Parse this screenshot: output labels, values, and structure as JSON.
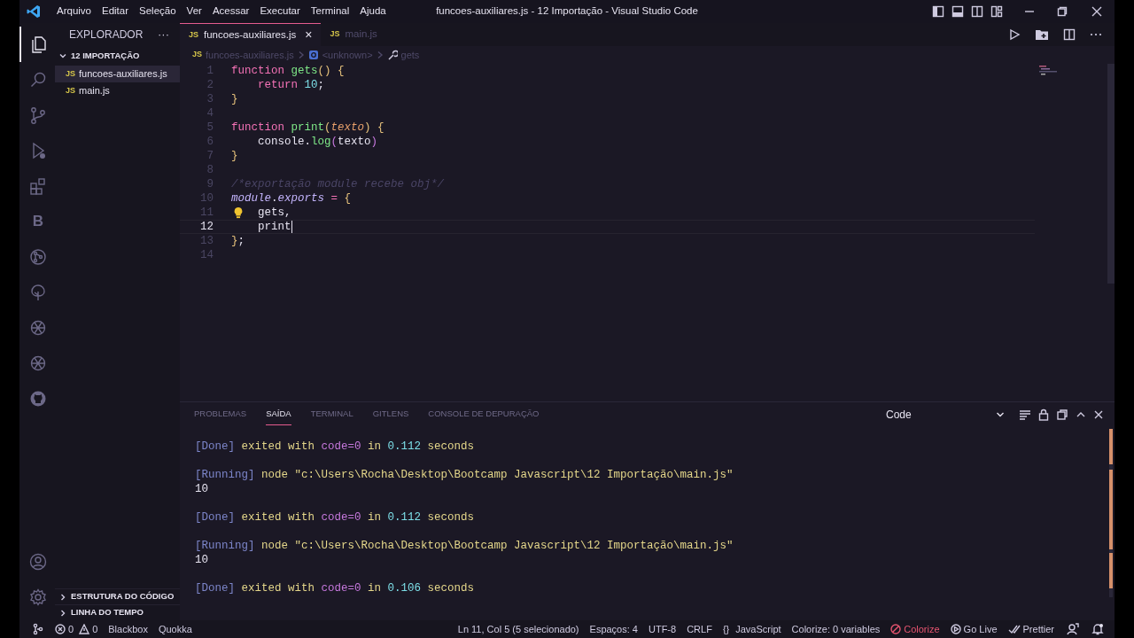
{
  "window": {
    "title": "funcoes-auxiliares.js - 12 Importação - Visual Studio Code"
  },
  "menu": [
    "Arquivo",
    "Editar",
    "Seleção",
    "Ver",
    "Acessar",
    "Executar",
    "Terminal",
    "Ajuda"
  ],
  "activity_bar": {
    "top": [
      {
        "kind": "explorer",
        "selected": true
      },
      {
        "kind": "search",
        "selected": false
      },
      {
        "kind": "source-control",
        "selected": false
      },
      {
        "kind": "run-debug",
        "selected": false
      },
      {
        "kind": "extensions",
        "selected": false
      },
      {
        "kind": "letter",
        "label": "B",
        "selected": false
      },
      {
        "kind": "gitlens",
        "selected": false
      },
      {
        "kind": "tree",
        "selected": false
      },
      {
        "kind": "openai",
        "selected": false
      },
      {
        "kind": "openai",
        "selected": false
      },
      {
        "kind": "github",
        "selected": false
      }
    ],
    "bottom": [
      {
        "kind": "account",
        "selected": false
      },
      {
        "kind": "settings",
        "selected": false
      }
    ]
  },
  "sidebar": {
    "title": "EXPLORADOR",
    "more": "···",
    "folder": {
      "label": "12 IMPORTAÇÃO",
      "expanded": true,
      "files": [
        {
          "badge": "JS",
          "name": "funcoes-auxiliares.js",
          "selected": true
        },
        {
          "badge": "JS",
          "name": "main.js",
          "selected": false
        }
      ]
    },
    "sections": [
      {
        "label": "ESTRUTURA DO CÓDIGO",
        "expanded": false
      },
      {
        "label": "LINHA DO TEMPO",
        "expanded": false
      }
    ]
  },
  "editor_tabs": [
    {
      "badge": "JS",
      "label": "funcoes-auxiliares.js",
      "selected": true,
      "close": "×"
    },
    {
      "badge": "JS",
      "label": "main.js",
      "selected": false
    }
  ],
  "breadcrumb": [
    {
      "badge": "JS",
      "label": "funcoes-auxiliares.js",
      "kind": "file"
    },
    {
      "label": "<unknown>",
      "kind": "object"
    },
    {
      "label": "gets",
      "kind": "wrench"
    }
  ],
  "code_lines": [
    {
      "number": "1",
      "current": false,
      "tokens": [
        {
          "t": "function ",
          "kind": "kw"
        },
        {
          "t": "gets",
          "kind": "fn"
        },
        {
          "t": "() {",
          "kind": "brace"
        }
      ]
    },
    {
      "number": "2",
      "current": false,
      "tokens": [
        {
          "t": "    return ",
          "kind": "kw"
        },
        {
          "t": "10",
          "kind": "num"
        },
        {
          "t": ";",
          "kind": "plain"
        }
      ]
    },
    {
      "number": "3",
      "current": false,
      "tokens": [
        {
          "t": "}",
          "kind": "brace"
        }
      ]
    },
    {
      "number": "4",
      "current": false
    },
    {
      "number": "5",
      "current": false,
      "tokens": [
        {
          "t": "function ",
          "kind": "kw"
        },
        {
          "t": "print",
          "kind": "fn"
        },
        {
          "t": "(",
          "kind": "brace"
        },
        {
          "t": "texto",
          "kind": "param"
        },
        {
          "t": ") {",
          "kind": "brace"
        }
      ]
    },
    {
      "number": "6",
      "current": false,
      "tokens": [
        {
          "t": "    console.",
          "kind": "plain"
        },
        {
          "t": "log",
          "kind": "fn"
        },
        {
          "t": "(",
          "kind": "paren"
        },
        {
          "t": "texto",
          "kind": "plain"
        },
        {
          "t": ")",
          "kind": "paren"
        }
      ]
    },
    {
      "number": "7",
      "current": false,
      "tokens": [
        {
          "t": "}",
          "kind": "brace"
        }
      ]
    },
    {
      "number": "8",
      "current": false
    },
    {
      "number": "9",
      "current": false,
      "tokens": [
        {
          "t": "/*exportação module recebe obj*/",
          "kind": "comment"
        }
      ]
    },
    {
      "number": "10",
      "current": false,
      "tokens": [
        {
          "t": "module",
          "kind": "obj"
        },
        {
          "t": ".",
          "kind": "plain"
        },
        {
          "t": "exports",
          "kind": "obj"
        },
        {
          "t": " = ",
          "kind": "op"
        },
        {
          "t": "{",
          "kind": "brace"
        }
      ]
    },
    {
      "number": "11",
      "current": false,
      "lightbulb": true,
      "tokens": [
        {
          "t": "    gets,",
          "kind": "plain"
        }
      ]
    },
    {
      "number": "12",
      "current": true,
      "cursor": true,
      "tokens": [
        {
          "t": "    print",
          "kind": "plain"
        }
      ]
    },
    {
      "number": "13",
      "current": false,
      "tokens": [
        {
          "t": "}",
          "kind": "brace"
        },
        {
          "t": ";",
          "kind": "plain"
        }
      ]
    },
    {
      "number": "14",
      "current": false
    }
  ],
  "panel": {
    "tabs": [
      {
        "label": "PROBLEMAS",
        "selected": false
      },
      {
        "label": "SAÍDA",
        "selected": true
      },
      {
        "label": "TERMINAL",
        "selected": false
      },
      {
        "label": "GITLENS",
        "selected": false
      },
      {
        "label": "CONSOLE DE DEPURAÇÃO",
        "selected": false
      }
    ],
    "channel": "Code",
    "output": [
      [
        [
          {
            "t": "[Done] ",
            "kind": "tag"
          },
          {
            "t": "exited with ",
            "kind": "text"
          },
          {
            "t": "code=0",
            "kind": "key"
          },
          {
            "t": " in ",
            "kind": "text"
          },
          {
            "t": "0.112",
            "kind": "num"
          },
          {
            "t": " seconds",
            "kind": "text"
          }
        ]
      ],
      [
        [
          {
            "t": "[Running] ",
            "kind": "tag"
          },
          {
            "t": "node \"c:\\Users\\Rocha\\Desktop\\Bootcamp Javascript\\12 Importação\\main.js\"",
            "kind": "text"
          }
        ],
        [
          {
            "t": "10",
            "kind": "out"
          }
        ]
      ],
      [
        [
          {
            "t": "[Done] ",
            "kind": "tag"
          },
          {
            "t": "exited with ",
            "kind": "text"
          },
          {
            "t": "code=0",
            "kind": "key"
          },
          {
            "t": " in ",
            "kind": "text"
          },
          {
            "t": "0.112",
            "kind": "num"
          },
          {
            "t": " seconds",
            "kind": "text"
          }
        ]
      ],
      [
        [
          {
            "t": "[Running] ",
            "kind": "tag"
          },
          {
            "t": "node \"c:\\Users\\Rocha\\Desktop\\Bootcamp Javascript\\12 Importação\\main.js\"",
            "kind": "text"
          }
        ],
        [
          {
            "t": "10",
            "kind": "out"
          }
        ]
      ],
      [
        [
          {
            "t": "[Done] ",
            "kind": "tag"
          },
          {
            "t": "exited with ",
            "kind": "text"
          },
          {
            "t": "code=0",
            "kind": "key"
          },
          {
            "t": " in ",
            "kind": "text"
          },
          {
            "t": "0.106",
            "kind": "num"
          },
          {
            "t": " seconds",
            "kind": "text"
          }
        ]
      ]
    ]
  },
  "status_bar": {
    "left": [
      {
        "kind": "remote"
      },
      {
        "kind": "problems",
        "errors": "0",
        "warnings": "0"
      },
      {
        "kind": "text",
        "label": "Blackbox"
      },
      {
        "kind": "text",
        "label": "Quokka"
      }
    ],
    "right": [
      {
        "kind": "text",
        "label": "Ln 11, Col 5 (5 selecionado)"
      },
      {
        "kind": "text",
        "label": "Espaços: 4"
      },
      {
        "kind": "text",
        "label": "UTF-8"
      },
      {
        "kind": "text",
        "label": "CRLF"
      },
      {
        "kind": "language",
        "braces": "{}",
        "label": "JavaScript"
      },
      {
        "kind": "text",
        "label": "Colorize: 0 variables"
      },
      {
        "kind": "alert",
        "label": "Colorize"
      },
      {
        "kind": "golive",
        "label": "Go Live"
      },
      {
        "kind": "prettier",
        "label": "Prettier"
      },
      {
        "kind": "feedback"
      },
      {
        "kind": "bell"
      }
    ]
  }
}
